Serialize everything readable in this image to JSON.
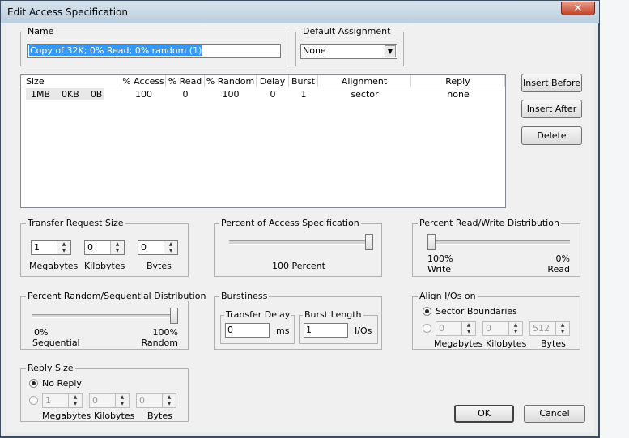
{
  "window": {
    "title": "Edit Access Specification",
    "close_glyph": "✕"
  },
  "name_group": {
    "label": "Name",
    "value": "Copy of 32K; 0% Read; 0% random (1)"
  },
  "default_assignment": {
    "label": "Default Assignment",
    "value": "None",
    "arrow": "▼"
  },
  "table": {
    "columns": [
      "Size",
      "% Access",
      "% Read",
      "% Random",
      "Delay",
      "Burst",
      "Alignment",
      "Reply"
    ],
    "rows": [
      {
        "size_mb": "1MB",
        "size_kb": "0KB",
        "size_b": "0B",
        "access": "100",
        "read": "0",
        "random": "100",
        "delay": "0",
        "burst": "1",
        "alignment": "sector",
        "reply": "none"
      }
    ]
  },
  "buttons": {
    "insert_before": "Insert Before",
    "insert_after": "Insert After",
    "delete": "Delete",
    "ok": "OK",
    "cancel": "Cancel"
  },
  "transfer_request_size": {
    "label": "Transfer Request Size",
    "megabytes": "1",
    "kilobytes": "0",
    "bytes": "0",
    "units": {
      "mb": "Megabytes",
      "kb": "Kilobytes",
      "b": "Bytes"
    }
  },
  "percent_access": {
    "label": "Percent of Access Specification",
    "value_text": "100 Percent",
    "value": 100
  },
  "read_write": {
    "label": "Percent Read/Write Distribution",
    "left_pct": "100%",
    "left_label": "Write",
    "right_pct": "0%",
    "right_label": "Read",
    "read_value": 0
  },
  "random_sequential": {
    "label": "Percent Random/Sequential Distribution",
    "left_pct": "0%",
    "left_label": "Sequential",
    "right_pct": "100%",
    "right_label": "Random",
    "random_value": 100
  },
  "burstiness": {
    "label": "Burstiness",
    "transfer_delay": {
      "label": "Transfer Delay",
      "value": "0",
      "unit": "ms"
    },
    "burst_length": {
      "label": "Burst Length",
      "value": "1",
      "unit": "I/Os"
    }
  },
  "align_ios": {
    "label": "Align I/Os on",
    "sector_boundaries": "Sector Boundaries",
    "megabytes": "0",
    "kilobytes": "0",
    "bytes": "512",
    "units": {
      "mb": "Megabytes",
      "kb": "Kilobytes",
      "b": "Bytes"
    }
  },
  "reply_size": {
    "label": "Reply Size",
    "no_reply": "No Reply",
    "megabytes": "1",
    "kilobytes": "0",
    "bytes": "0",
    "units": {
      "mb": "Megabytes",
      "kb": "Kilobytes",
      "b": "Bytes"
    }
  },
  "colors": {
    "selection": "#3399ff",
    "close_button": "#c2422a"
  }
}
